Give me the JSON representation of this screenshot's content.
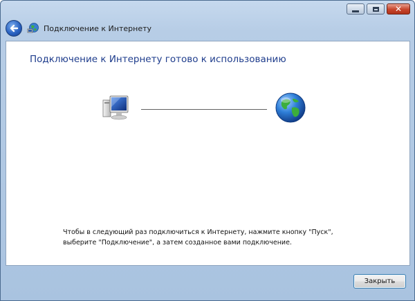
{
  "window": {
    "title": "Подключение к Интернету",
    "caption_buttons": [
      "minimize",
      "maximize",
      "close"
    ]
  },
  "nav": {
    "back_icon": "back-arrow-icon",
    "app_icon": "network-connection-icon",
    "title": "Подключение к Интернету"
  },
  "main": {
    "heading": "Подключение к Интернету готово к использованию",
    "computer_icon": "computer-icon",
    "globe_icon": "globe-icon",
    "info_line1": "Чтобы в следующий раз подключиться к Интернету, нажмите кнопку \"Пуск\",",
    "info_line2": "выберите \"Подключение\", а затем созданное вами подключение."
  },
  "footer": {
    "close_label": "Закрыть"
  },
  "colors": {
    "heading": "#1e3c8c",
    "chrome": "#b7cde6",
    "close_caption": "#c7452c"
  }
}
